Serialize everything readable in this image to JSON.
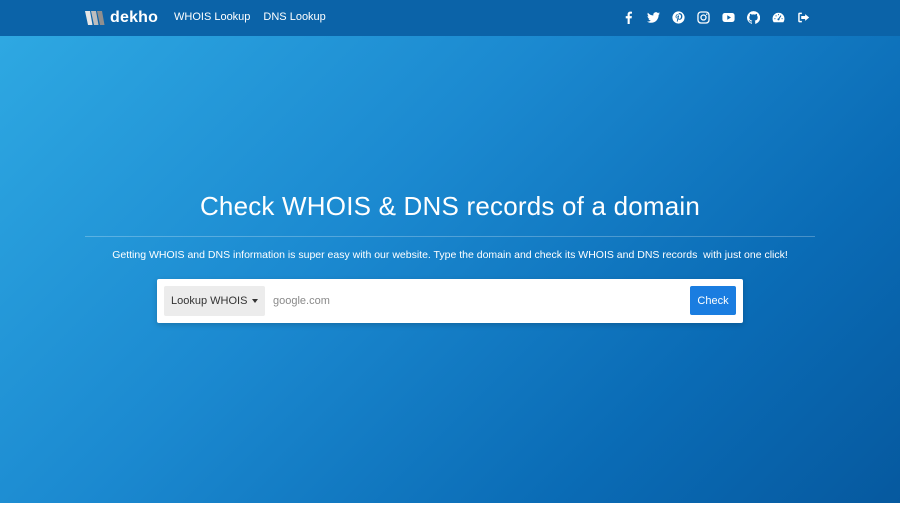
{
  "navbar": {
    "brand": {
      "name": "dekho",
      "logo_icon": "dekho-logo-icon"
    },
    "links": [
      {
        "label": "WHOIS Lookup"
      },
      {
        "label": "DNS Lookup"
      }
    ],
    "social_icons": [
      "facebook-icon",
      "twitter-icon",
      "pinterest-icon",
      "instagram-icon",
      "youtube-icon",
      "github-icon",
      "dashboard-icon",
      "sign-out-icon"
    ],
    "colors": {
      "background": "#0b63a8",
      "text": "#ffffff"
    }
  },
  "hero": {
    "title": "Check WHOIS & DNS records of a domain",
    "description": "Getting WHOIS and DNS information is super easy with our website. Type the domain and check its WHOIS and DNS records  with just one click!",
    "colors": {
      "gradient_start": "#2ea8e2",
      "gradient_end": "#06599f"
    }
  },
  "search": {
    "lookup_type": "Lookup WHOIS",
    "input_value": "",
    "placeholder": "google.com",
    "button_label": "Check",
    "colors": {
      "button": "#1a7de0"
    }
  }
}
